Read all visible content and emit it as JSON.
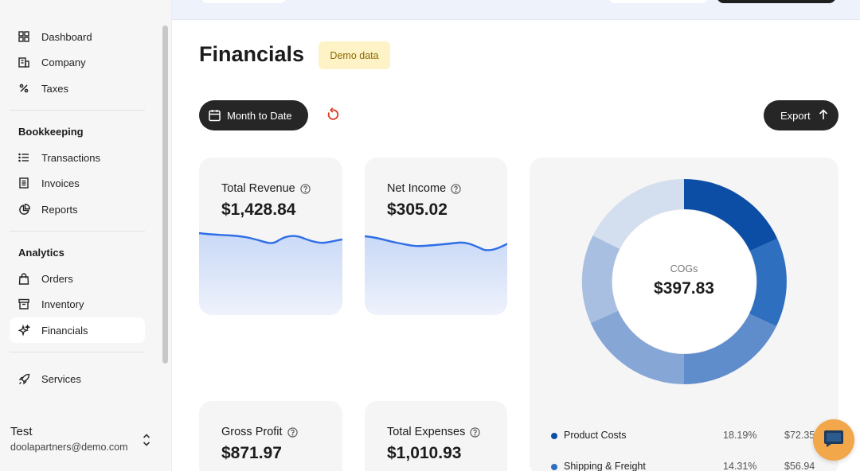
{
  "sidebar": {
    "items_top": [
      {
        "label": "Dashboard",
        "icon": "grid-icon"
      },
      {
        "label": "Company",
        "icon": "building-icon"
      },
      {
        "label": "Taxes",
        "icon": "percent-icon"
      }
    ],
    "bookkeeping": {
      "title": "Bookkeeping",
      "items": [
        {
          "label": "Transactions",
          "icon": "list-icon"
        },
        {
          "label": "Invoices",
          "icon": "invoice-icon"
        },
        {
          "label": "Reports",
          "icon": "pie-chart-icon"
        }
      ]
    },
    "analytics": {
      "title": "Analytics",
      "items": [
        {
          "label": "Orders",
          "icon": "shopping-bag-icon"
        },
        {
          "label": "Inventory",
          "icon": "archive-box-icon"
        },
        {
          "label": "Financials",
          "icon": "sparkles-icon"
        }
      ]
    },
    "items_bottom": [
      {
        "label": "Services",
        "icon": "rocket-icon"
      }
    ],
    "user": {
      "name": "Test",
      "email": "doolapartners@demo.com"
    }
  },
  "main": {
    "title": "Financials",
    "badge": "Demo data",
    "date_button": "Month to Date",
    "export_button": "Export"
  },
  "cards": {
    "revenue": {
      "label": "Total Revenue",
      "value": "$1,428.84"
    },
    "net_income": {
      "label": "Net Income",
      "value": "$305.02"
    },
    "gross_profit": {
      "label": "Gross Profit",
      "value": "$871.97"
    },
    "expenses": {
      "label": "Total Expenses",
      "value": "$1,010.93"
    }
  },
  "cogs": {
    "label": "COGs",
    "value": "$397.83",
    "legend": [
      {
        "name": "Product Costs",
        "pct": "18.19%",
        "amount": "$72.35",
        "color": "#0c4ea6"
      },
      {
        "name": "Shipping & Freight",
        "pct": "14.31%",
        "amount": "$56.94",
        "color": "#2f6fbf"
      }
    ]
  },
  "colors": {
    "accent": "#0c4ea6",
    "dark_button": "#262626",
    "badge_bg": "#fdf3c7",
    "spark_line": "#2f6ee5",
    "reset_icon": "#d9391e",
    "chat": "#f2a74b"
  }
}
